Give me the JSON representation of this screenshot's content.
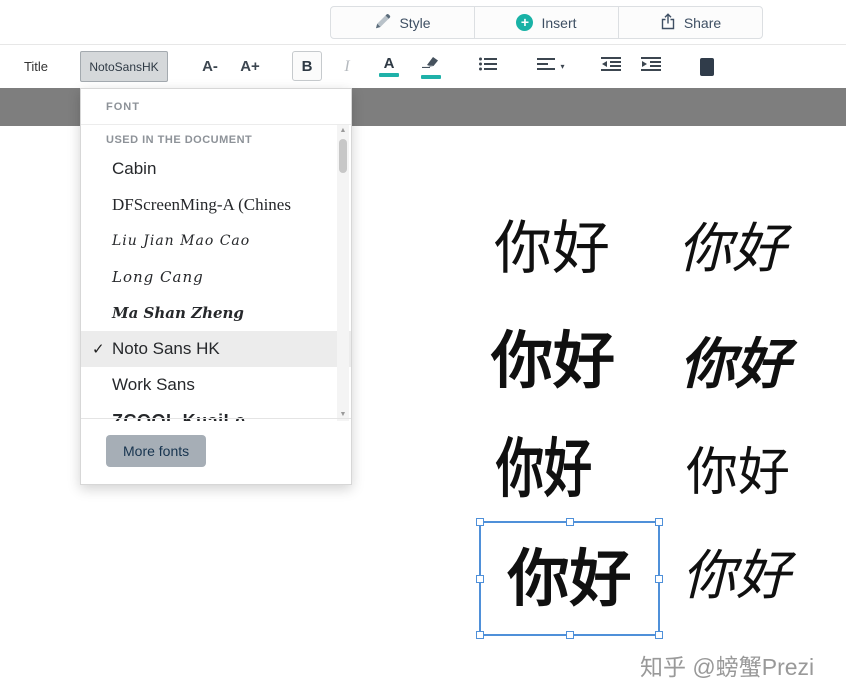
{
  "colors": {
    "accent": "#1fb1a9",
    "selection": "#4f90d9",
    "workspace_gray": "#7e7e7e"
  },
  "icons": {
    "plus": "+",
    "check": "✓",
    "scroll_up": "▲",
    "scroll_down": "▼",
    "caret": "▾"
  },
  "top_bar": {
    "style_label": "Style",
    "insert_label": "Insert",
    "share_label": "Share"
  },
  "toolbar": {
    "title_label": "Title",
    "font_button_label": "NotoSansHK",
    "decrease_font_label": "A-",
    "increase_font_label": "A+",
    "bold_label": "B",
    "italic_label": "I",
    "text_color_label": "A"
  },
  "font_dropdown": {
    "header": "FONT",
    "section_header": "USED IN THE DOCUMENT",
    "fonts": [
      {
        "name": "Cabin",
        "selected": false
      },
      {
        "name": "DFScreenMing-A (Chines",
        "selected": false
      },
      {
        "name": "Liu Jian Mao Cao",
        "selected": false
      },
      {
        "name": "Long Cang",
        "selected": false
      },
      {
        "name": "Ma Shan Zheng",
        "selected": false
      },
      {
        "name": "Noto Sans HK",
        "selected": true
      },
      {
        "name": "Work Sans",
        "selected": false
      },
      {
        "name": "ZCOOL KuaiLe",
        "selected": false
      }
    ],
    "more_fonts_label": "More fonts"
  },
  "canvas": {
    "samples": [
      {
        "text": "你好"
      },
      {
        "text": "你好"
      },
      {
        "text": "你好"
      },
      {
        "text": "你好"
      },
      {
        "text": "你好"
      },
      {
        "text": "你好"
      },
      {
        "text": "你好"
      },
      {
        "text": "你好"
      }
    ],
    "watermark": "知乎 @螃蟹Prezi"
  }
}
